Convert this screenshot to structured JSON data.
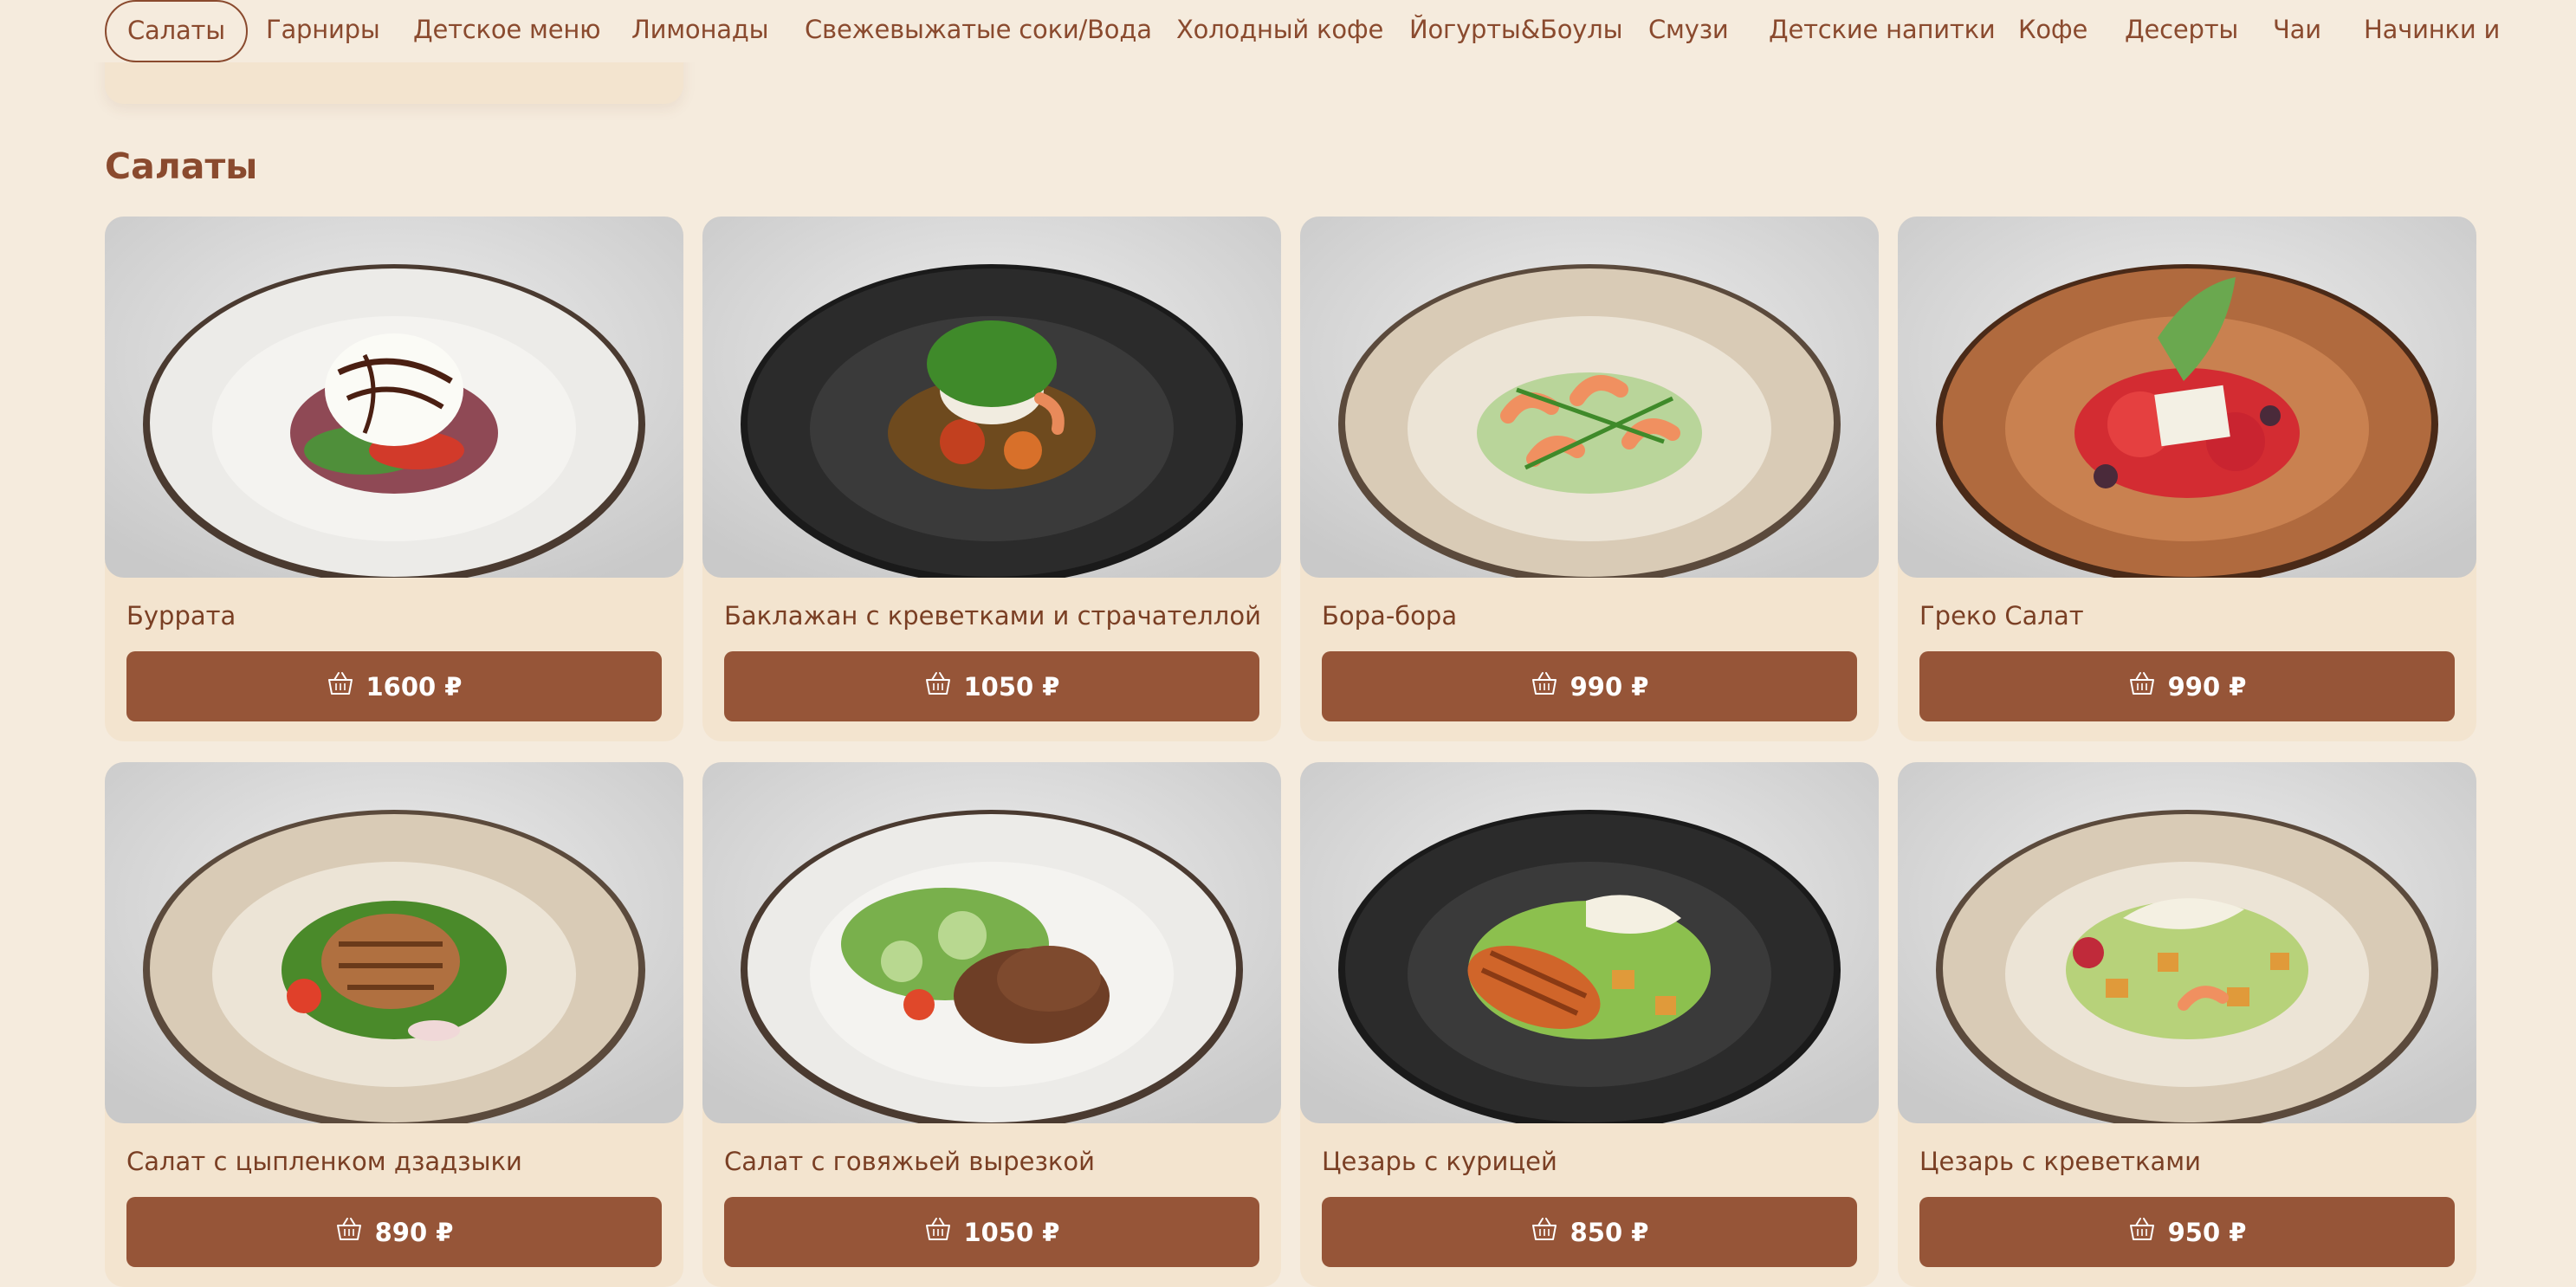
{
  "nav": {
    "items": [
      "Салаты",
      "Гарниры",
      "Детское меню",
      "Лимонады",
      "Свежевыжатые соки/Вода",
      "Холодный кофе",
      "Йогурты&Боулы",
      "Смузи",
      "Детские напитки",
      "Кофе",
      "Десерты",
      "Чаи",
      "Начинки и с"
    ],
    "active": "Салаты"
  },
  "section": {
    "title": "Салаты"
  },
  "currency": "₽",
  "products": [
    {
      "name": "Буррата",
      "price": "1600 ₽",
      "plate": "light",
      "food": "burrata"
    },
    {
      "name": "Баклажан с креветками и страчателлой",
      "price": "1050 ₽",
      "plate": "dark",
      "food": "eggplant"
    },
    {
      "name": "Бора-бора",
      "price": "990 ₽",
      "plate": "beige",
      "food": "shrimp"
    },
    {
      "name": "Греко Салат",
      "price": "990 ₽",
      "plate": "terracotta",
      "food": "greek"
    },
    {
      "name": "Салат с цыпленком дзадзыки",
      "price": "890 ₽",
      "plate": "beige",
      "food": "chicken"
    },
    {
      "name": "Салат с говяжьей вырезкой",
      "price": "1050 ₽",
      "plate": "light",
      "food": "beef"
    },
    {
      "name": "Цезарь с курицей",
      "price": "850 ₽",
      "plate": "dark",
      "food": "caesar-chicken"
    },
    {
      "name": "Цезарь с креветками",
      "price": "950 ₽",
      "plate": "beige",
      "food": "caesar-shrimp"
    }
  ],
  "colors": {
    "background": "#f5ebdd",
    "card": "#f3e4cf",
    "accent": "#965538",
    "text": "#8a4a2e"
  },
  "icons": {
    "cart": "basket-icon"
  }
}
